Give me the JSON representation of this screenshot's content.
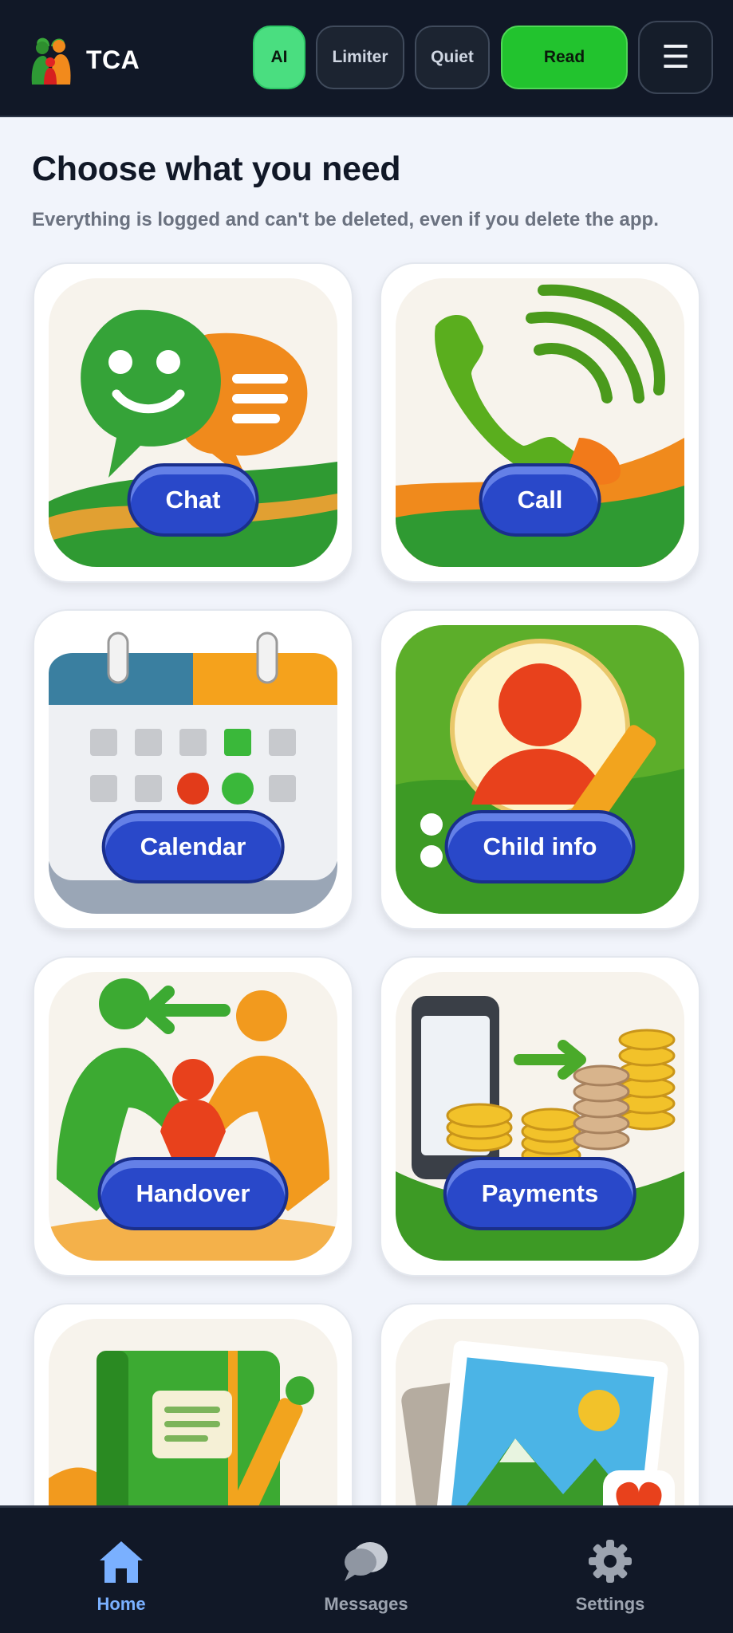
{
  "app": {
    "name": "TCA"
  },
  "header": {
    "pills": {
      "ai": "AI",
      "limiter": "Limiter",
      "quiet": "Quiet",
      "read": "Read"
    },
    "menu_icon": "menu-icon"
  },
  "main": {
    "title": "Choose what you need",
    "subtitle": "Everything is logged and can't be deleted, even if you delete the app.",
    "tiles": [
      {
        "label": "Chat",
        "icon": "chat-bubbles-icon"
      },
      {
        "label": "Call",
        "icon": "phone-icon"
      },
      {
        "label": "Calendar",
        "icon": "calendar-icon"
      },
      {
        "label": "Child info",
        "icon": "child-profile-icon"
      },
      {
        "label": "Handover",
        "icon": "handover-icon"
      },
      {
        "label": "Payments",
        "icon": "payments-icon"
      },
      {
        "label": "",
        "icon": "journal-icon"
      },
      {
        "label": "",
        "icon": "photos-icon"
      }
    ]
  },
  "nav": {
    "items": [
      {
        "label": "Home",
        "icon": "home-icon",
        "active": true
      },
      {
        "label": "Messages",
        "icon": "messages-icon",
        "active": false
      },
      {
        "label": "Settings",
        "icon": "settings-icon",
        "active": false
      }
    ]
  },
  "colors": {
    "header_bg": "#111827",
    "accent_green": "#22c32e",
    "ai_green": "#4ade80",
    "label_blue": "#2948c9",
    "active_nav": "#7ab0ff"
  }
}
